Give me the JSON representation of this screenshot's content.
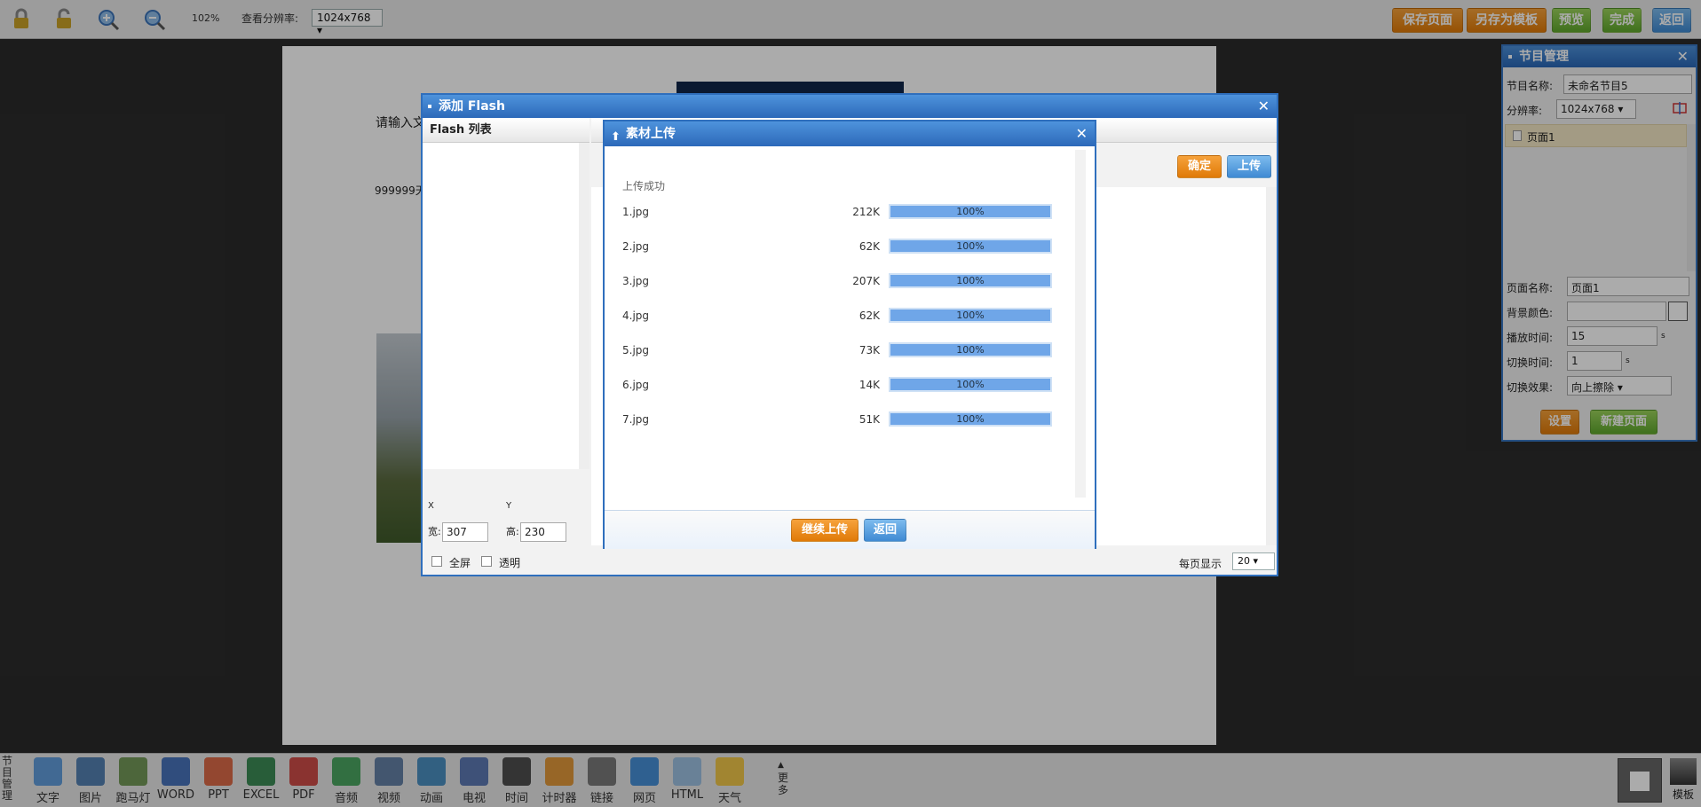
{
  "toolbar": {
    "zoom": "102%",
    "resolution_label": "查看分辨率:",
    "resolution_value": "1024x768",
    "save_page": "保存页面",
    "save_as_template": "另存为模板",
    "preview": "预览",
    "finish": "完成",
    "back": "返回"
  },
  "canvas": {
    "text1": "请输入文",
    "text2": "999999天"
  },
  "program_panel": {
    "title": "节目管理",
    "name_label": "节目名称:",
    "name_value": "未命名节目5",
    "resolution_label": "分辨率:",
    "resolution_value": "1024x768",
    "page_item": "页面1",
    "page_name_label": "页面名称:",
    "page_name_value": "页面1",
    "bg_color_label": "背景颜色:",
    "play_time_label": "播放时间:",
    "play_time_value": "15",
    "play_unit": "s",
    "switch_time_label": "切换时间:",
    "switch_time_value": "1",
    "switch_unit": "s",
    "effect_label": "切换效果:",
    "effect_value": "向上擦除",
    "set_btn": "设置",
    "new_page_btn": "新建页面"
  },
  "flash_dialog": {
    "title": "添加 Flash",
    "list_title": "Flash 列表",
    "x_label": "X",
    "y_label": "Y",
    "width_label": "宽:",
    "width_value": "307",
    "height_label": "高:",
    "height_value": "230",
    "fullscreen": "全屏",
    "transparent": "透明",
    "confirm": "确定",
    "upload": "上传",
    "per_page_label": "每页显示",
    "per_page_value": "20"
  },
  "upload_dialog": {
    "title": "素材上传",
    "status": "上传成功",
    "files": [
      {
        "name": "1.jpg",
        "size": "212K",
        "progress": "100%"
      },
      {
        "name": "2.jpg",
        "size": "62K",
        "progress": "100%"
      },
      {
        "name": "3.jpg",
        "size": "207K",
        "progress": "100%"
      },
      {
        "name": "4.jpg",
        "size": "62K",
        "progress": "100%"
      },
      {
        "name": "5.jpg",
        "size": "73K",
        "progress": "100%"
      },
      {
        "name": "6.jpg",
        "size": "14K",
        "progress": "100%"
      },
      {
        "name": "7.jpg",
        "size": "51K",
        "progress": "100%"
      }
    ],
    "continue_btn": "继续上传",
    "back_btn": "返回"
  },
  "bottom": {
    "program_mgmt": "节目管理",
    "items": [
      "文字",
      "图片",
      "跑马灯",
      "WORD",
      "PPT",
      "EXCEL",
      "PDF",
      "音频",
      "视频",
      "动画",
      "电视",
      "时间",
      "计时器",
      "链接",
      "网页",
      "HTML",
      "天气"
    ],
    "more": "更多",
    "template": "模板"
  },
  "colors": {
    "orange": "#e98a16",
    "green": "#6cb33a",
    "blue": "#4a92da",
    "dialog_border": "#2f6fbd"
  }
}
